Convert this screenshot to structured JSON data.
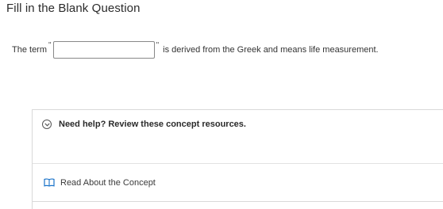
{
  "header": {
    "title": "Fill in the Blank Question"
  },
  "question": {
    "prefix": "The term",
    "blank_value": "",
    "suffix": "is derived from the Greek and means life measurement."
  },
  "help": {
    "label": "Need help? Review these concept resources.",
    "icon": "chevron-down-circle-icon",
    "resources": [
      {
        "label": "Read About the Concept",
        "icon": "book-icon"
      }
    ]
  },
  "colors": {
    "accent_icon": "#1a73c9",
    "text": "#2b2b2b",
    "border": "#d9d9d9"
  }
}
